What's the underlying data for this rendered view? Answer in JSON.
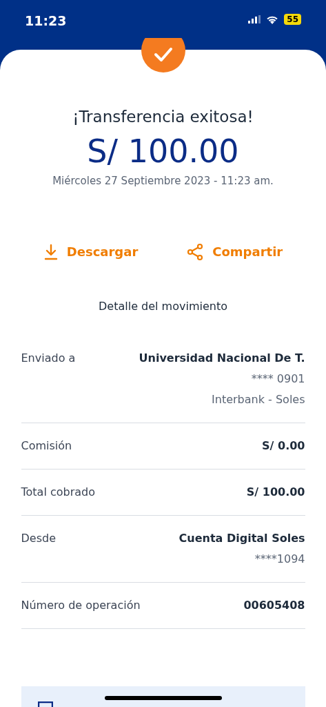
{
  "status_bar": {
    "time": "11:23",
    "battery": "55"
  },
  "title": "¡Transferencia exitosa!",
  "amount": "S/ 100.00",
  "date": "Miércoles 27 Septiembre 2023 - 11:23 am.",
  "actions": [
    {
      "kind": "download",
      "label": "Descargar"
    },
    {
      "kind": "share",
      "label": "Compartir"
    }
  ],
  "section_title": "Detalle del movimiento",
  "details": [
    {
      "label": "Enviado a",
      "values": [
        "Universidad Nacional De T.",
        "**** 0901",
        "Interbank - Soles"
      ]
    },
    {
      "label": "Comisión",
      "values": [
        "S/ 0.00"
      ]
    },
    {
      "label": "Total cobrado",
      "values": [
        "S/ 100.00"
      ]
    },
    {
      "label": "Desde",
      "values": [
        "Cuenta Digital Soles",
        "****1094"
      ]
    },
    {
      "label": "Número de operación",
      "values": [
        "00605408"
      ]
    }
  ]
}
